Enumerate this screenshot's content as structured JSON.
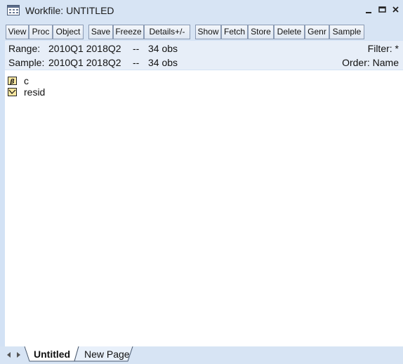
{
  "window": {
    "title": "Workfile: UNTITLED",
    "minimize_glyph": "‗",
    "restore_glyph": "▭",
    "close_glyph": "✕"
  },
  "toolbar": {
    "buttons": [
      "View",
      "Proc",
      "Object",
      "Save",
      "Freeze",
      "Details+/-",
      "Show",
      "Fetch",
      "Store",
      "Delete",
      "Genr",
      "Sample"
    ]
  },
  "info": {
    "range_label": "Range:",
    "range_value": "2010Q1 2018Q2",
    "range_sep": "--",
    "range_obs": "34 obs",
    "sample_label": "Sample:",
    "sample_value": "2010Q1 2018Q2",
    "sample_sep": "--",
    "sample_obs": "34 obs",
    "filter": "Filter: *",
    "order": "Order: Name"
  },
  "objects": [
    {
      "name": "c",
      "icon": "coefficient-vector-icon"
    },
    {
      "name": "resid",
      "icon": "series-icon"
    }
  ],
  "tabs": {
    "left_arrow": "◄",
    "right_arrow": "►",
    "active": "Untitled",
    "new_page": "New Page"
  },
  "colors": {
    "chrome": "#d7e4f4",
    "info_bg": "#e7eef8",
    "icon_fill": "#f8e7a0"
  }
}
